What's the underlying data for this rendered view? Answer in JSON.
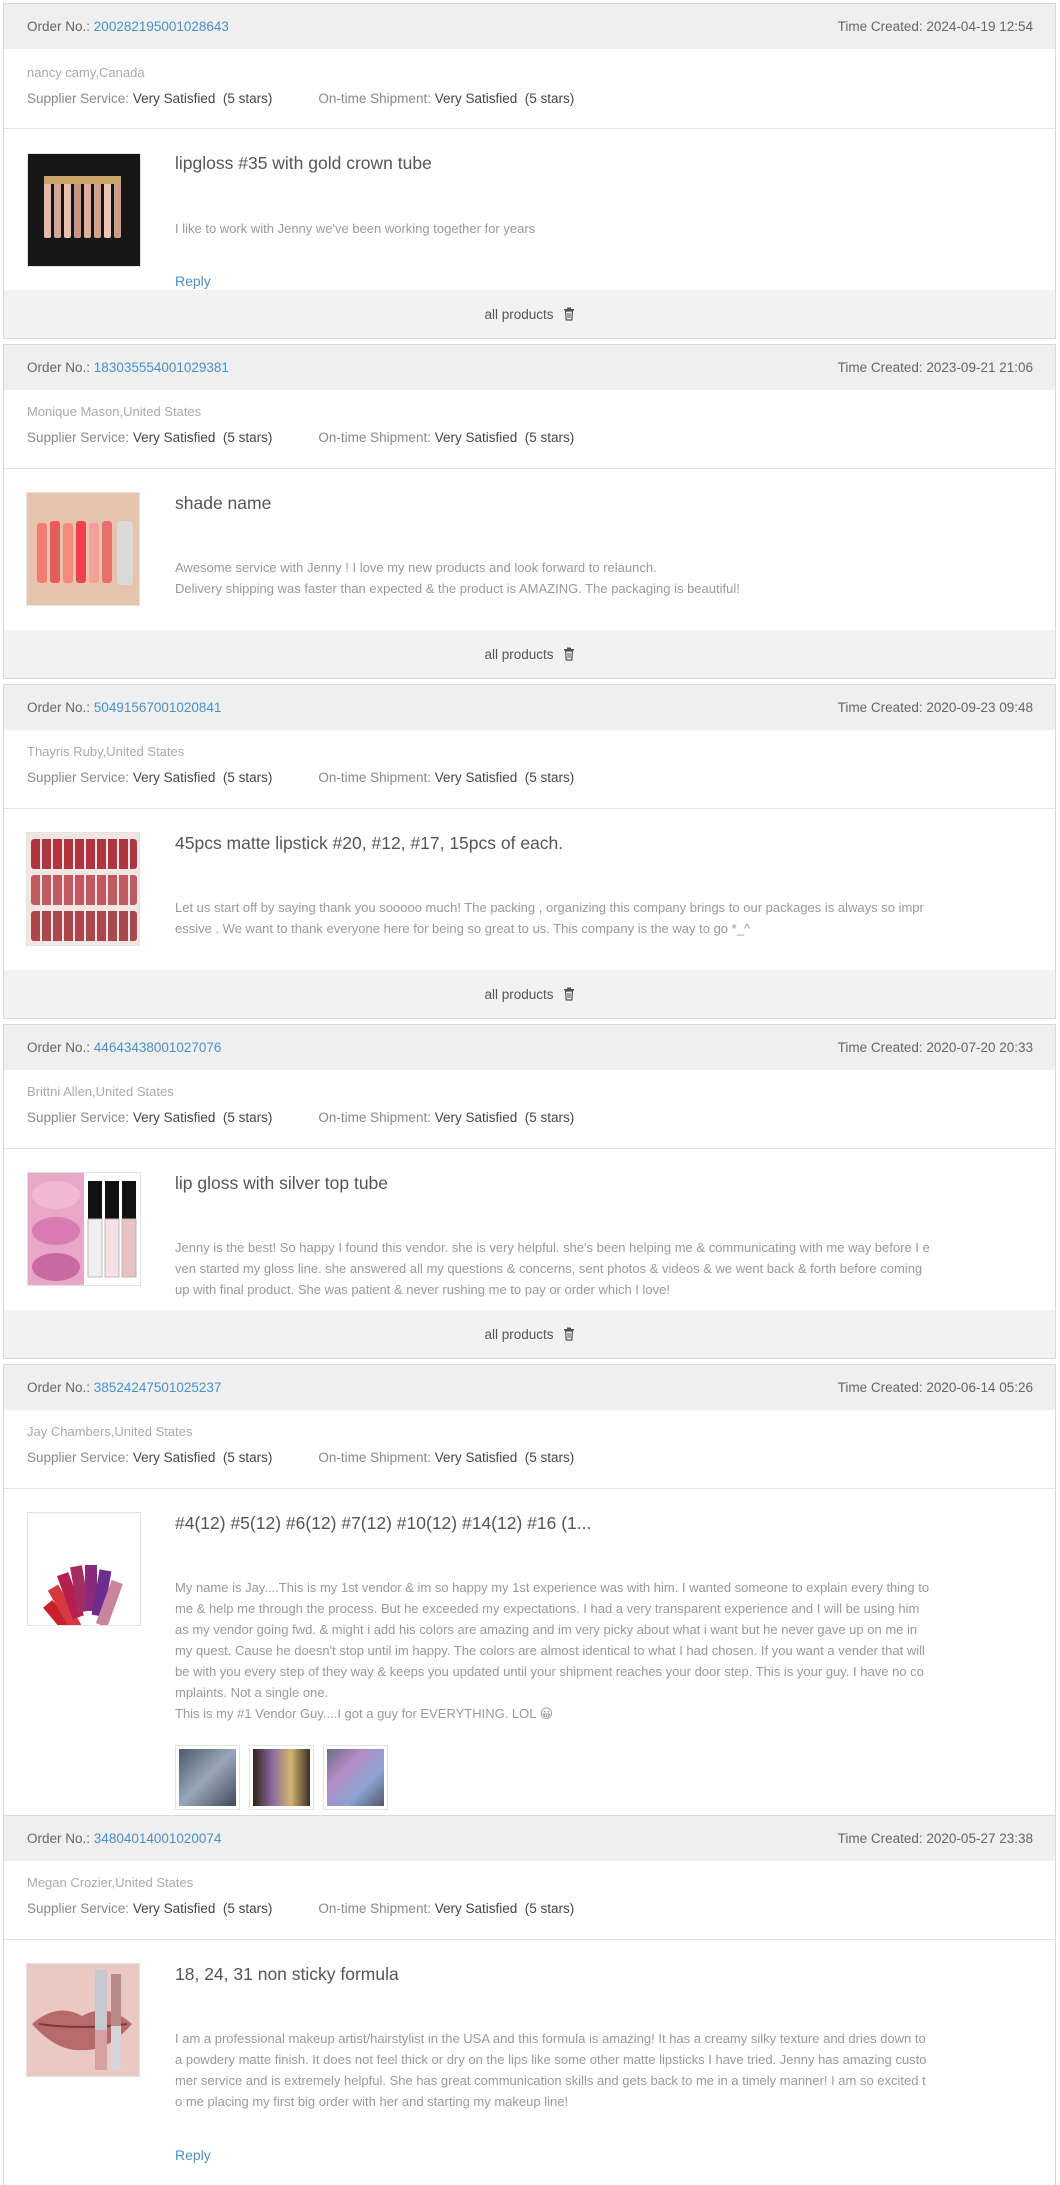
{
  "labels": {
    "order_no": "Order No.:",
    "time_created": "Time Created:",
    "supplier_service": "Supplier Service:",
    "ontime_shipment": "On-time Shipment:",
    "all_products": "all products",
    "reply": "Reply"
  },
  "reviews": [
    {
      "order_no": "200282195001028643",
      "time_created": "2024-04-19 12:54",
      "buyer": "nancy camy,Canada",
      "supplier_rating": "Very Satisfied",
      "supplier_stars": "(5 stars)",
      "shipment_rating": "Very Satisfied",
      "shipment_stars": "(5 stars)",
      "product_title": "lipgloss #35 with gold crown tube",
      "text": "I like to work with Jenny we've been working together for years",
      "thumb_icon": "lipgloss-row-image"
    },
    {
      "order_no": "183035554001029381",
      "time_created": "2023-09-21 21:06",
      "buyer": "Monique Mason,United States",
      "supplier_rating": "Very Satisfied",
      "supplier_stars": "(5 stars)",
      "shipment_rating": "Very Satisfied",
      "shipment_stars": "(5 stars)",
      "product_title": "shade name",
      "text": "Awesome service with Jenny ! I love my new products and look forward to relaunch.\nDelivery shipping was faster than expected & the product is AMAZING. The packaging is beautiful!",
      "thumb_icon": "lipstick-swatch-image"
    },
    {
      "order_no": "50491567001020841",
      "time_created": "2020-09-23 09:48",
      "buyer": "Thayris Ruby,United States",
      "supplier_rating": "Very Satisfied",
      "supplier_stars": "(5 stars)",
      "shipment_rating": "Very Satisfied",
      "shipment_stars": "(5 stars)",
      "product_title": "45pcs matte lipstick #20, #12, #17, 15pcs of each.",
      "text": "Let us start off by saying thank you sooooo much! The packing , organizing this company brings to our packages is always so impressive . We want to thank everyone here for being so great to us. This company is the way to go *_^",
      "thumb_icon": "matte-lipstick-grid-image"
    },
    {
      "order_no": "44643438001027076",
      "time_created": "2020-07-20 20:33",
      "buyer": "Brittni Allen,United States",
      "supplier_rating": "Very Satisfied",
      "supplier_stars": "(5 stars)",
      "shipment_rating": "Very Satisfied",
      "shipment_stars": "(5 stars)",
      "product_title": "lip gloss with silver top tube",
      "text": "Jenny is the best! So happy I found this vendor. she is very helpful. she's been helping me & communicating with me way before I even started my gloss line. she answered all my questions & concerns, sent photos & videos & we went back & forth before coming up with final product. She was patient & never rushing me to pay or order which I love!",
      "thumb_icon": "lip-gloss-tubes-image"
    },
    {
      "order_no": "38524247501025237",
      "time_created": "2020-06-14 05:26",
      "buyer": "Jay Chambers,United States",
      "supplier_rating": "Very Satisfied",
      "supplier_stars": "(5 stars)",
      "shipment_rating": "Very Satisfied",
      "shipment_stars": "(5 stars)",
      "product_title": "#4(12) #5(12) #6(12) #7(12) #10(12) #14(12) #16 (1...",
      "text": "My name is Jay....This is my 1st vendor & im so happy my 1st experience was with him. I wanted someone to explain every thing to me & help me through the process. But he exceeded my expectations. I had a very transparent experience and I will be using him as my vendor going fwd. & might i add his colors are amazing and im very picky about what i want but he never gave up on me in my quest. Cause he doesn't stop until im happy. The colors are almost identical to what I had chosen. If you want a vender that will be with you every step of they way & keeps you updated until your shipment reaches your door step. This is your guy. I have no complaints. Not a single one.\nThis is my #1 Vendor Guy....I got a guy for EVERYTHING. LOL 😀",
      "thumb_icon": "lip-gloss-fan-image"
    },
    {
      "order_no": "34804014001020074",
      "time_created": "2020-05-27 23:38",
      "buyer": "Megan Crozier,United States",
      "supplier_rating": "Very Satisfied",
      "supplier_stars": "(5 stars)",
      "shipment_rating": "Very Satisfied",
      "shipment_stars": "(5 stars)",
      "product_title": "18, 24, 31 non sticky formula",
      "text": "I am a professional makeup artist/hairstylist in the USA and this formula is amazing! It has a creamy silky texture and dries down to a powdery matte finish. It does not feel thick or dry on the lips like some other matte lipsticks I have tried. Jenny has amazing customer service and is extremely helpful. She has great communication skills and gets back to me in a timely manner! I am so excited to me placing my first big order with her and starting my makeup line!",
      "thumb_icon": "lips-and-lipstick-image"
    }
  ]
}
